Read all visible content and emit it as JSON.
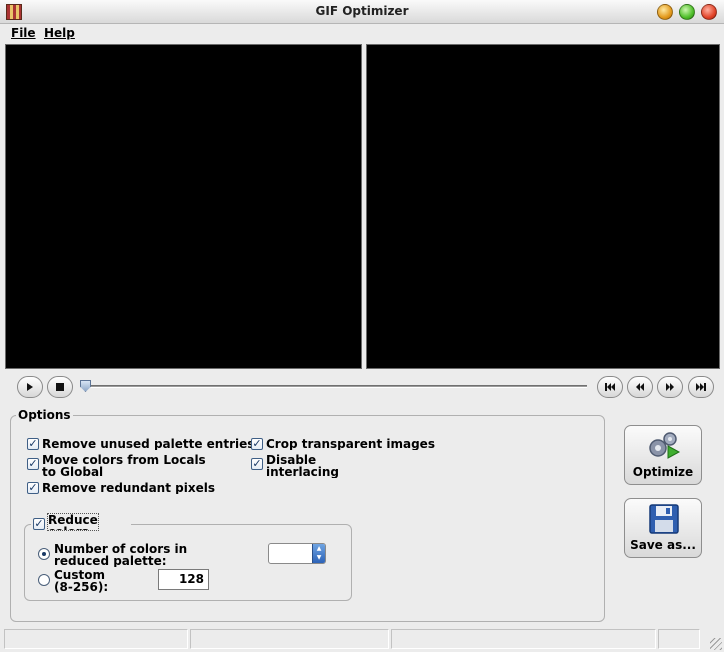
{
  "window": {
    "title": "GIF Optimizer"
  },
  "menu": {
    "items": [
      "File",
      "Help"
    ]
  },
  "playback": {
    "play_icon": "play-icon",
    "stop_icon": "stop-icon",
    "first_icon": "first-frame-icon",
    "prev_icon": "previous-frame-icon",
    "next_icon": "next-frame-icon",
    "last_icon": "last-frame-icon",
    "slider_position": 0
  },
  "options": {
    "title": "Options",
    "remove_unused_palette": {
      "label": "Remove unused palette entries",
      "checked": true
    },
    "crop_transparent": {
      "label": "Crop transparent images",
      "checked": true
    },
    "move_colors": {
      "label": "Move colors from Locals to Global",
      "checked": true
    },
    "disable_interlacing": {
      "label": "Disable interlacing",
      "checked": true
    },
    "remove_redundant": {
      "label": "Remove redundant pixels",
      "checked": true
    },
    "reduce_colors": {
      "label": "Reduce colors",
      "checked": true,
      "number_option": {
        "label": "Number of colors in reduced palette:",
        "selected": true,
        "value": ""
      },
      "custom_option": {
        "label": "Custom (8-256):",
        "selected": false,
        "value": "128"
      }
    }
  },
  "actions": {
    "optimize_label": "Optimize",
    "save_label": "Save as..."
  },
  "colors": {
    "preview_bg": "#000000",
    "accent": "#2d63b8"
  }
}
